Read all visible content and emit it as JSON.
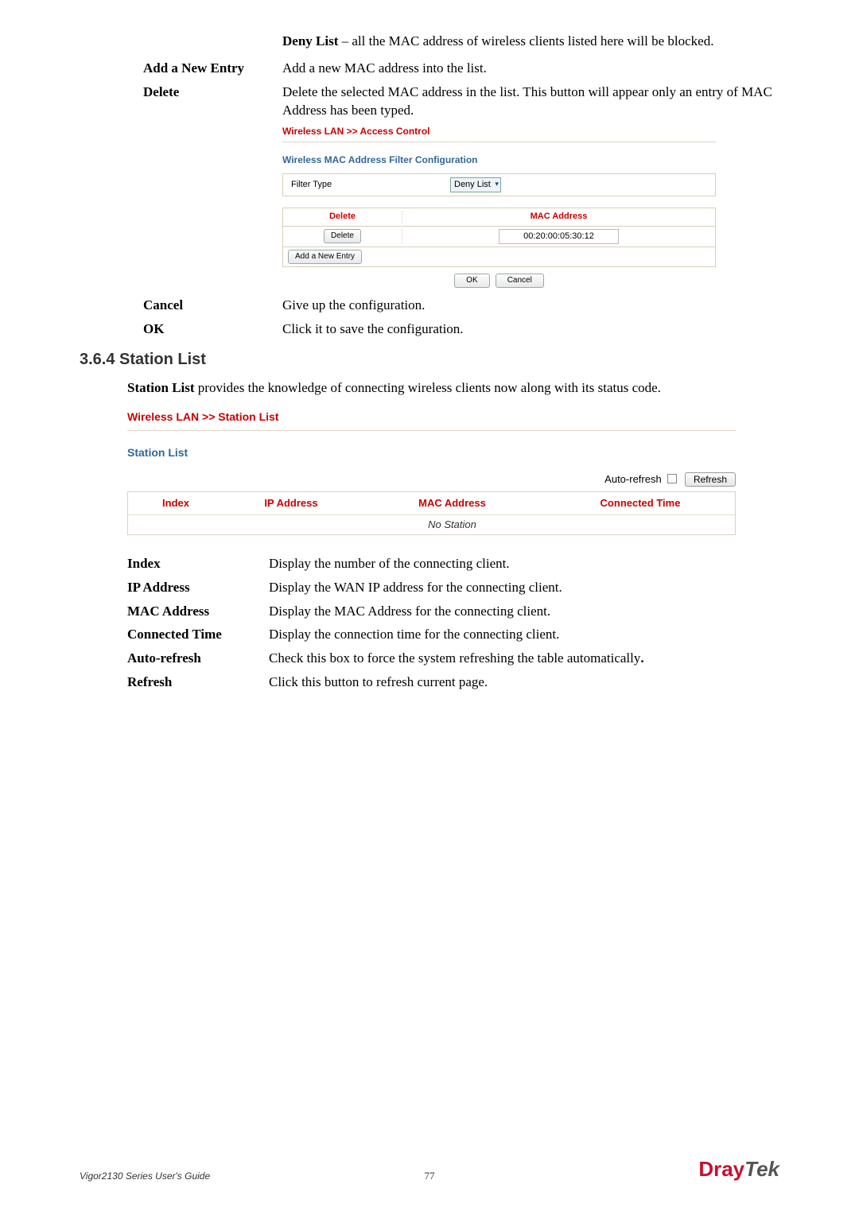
{
  "intro": {
    "deny_bold": "Deny List",
    "deny_rest": " – all the MAC address of wireless clients listed here will be blocked."
  },
  "defs1": {
    "add_new_entry_term": "Add a New Entry",
    "add_new_entry_desc": "Add a new MAC address into the list.",
    "delete_term": "Delete",
    "delete_desc": "Delete the selected MAC address in the list. This button will appear only an entry of MAC Address has been typed."
  },
  "access_ctrl": {
    "title": "Wireless LAN >> Access Control",
    "subtitle": "Wireless MAC Address Filter Configuration",
    "filter_type_label": "Filter Type",
    "filter_type_value": "Deny List",
    "col_delete": "Delete",
    "col_mac": "MAC Address",
    "row_delete_btn": "Delete",
    "row_mac": "00:20:00:05:30:12",
    "add_new_entry_btn": "Add a New Entry",
    "ok_btn": "OK",
    "cancel_btn": "Cancel"
  },
  "defs2": {
    "cancel_term": "Cancel",
    "cancel_desc": "Give up the configuration.",
    "ok_term": "OK",
    "ok_desc": "Click it to save the configuration."
  },
  "section_heading": "3.6.4 Station List",
  "section_para_bold": "Station List",
  "section_para_rest": " provides the knowledge of connecting wireless clients now along with its status code.",
  "stationlist": {
    "title": "Wireless LAN >> Station List",
    "subtitle": "Station List",
    "auto_refresh_label": "Auto-refresh",
    "refresh_btn": "Refresh",
    "col_index": "Index",
    "col_ip": "IP Address",
    "col_mac": "MAC Address",
    "col_time": "Connected Time",
    "no_station": "No Station"
  },
  "defs3": {
    "index_term": "Index",
    "index_desc": "Display the number of the connecting client.",
    "ip_term": "IP Address",
    "ip_desc": "Display the WAN IP address for the connecting client.",
    "mac_term": "MAC Address",
    "mac_desc": "Display the MAC Address for the connecting client.",
    "ct_term": "Connected Time",
    "ct_desc": "Display the connection time for the connecting client.",
    "ar_term": "Auto-refresh",
    "ar_desc_1": "Check this box to force the system refreshing the table automatically",
    "ar_desc_2": ".",
    "rf_term": "Refresh",
    "rf_desc": "Click this button to refresh current page."
  },
  "footer": {
    "left": "Vigor2130 Series User's Guide",
    "pageno": "77",
    "logo_dray": "Dray",
    "logo_tek": "Tek"
  }
}
